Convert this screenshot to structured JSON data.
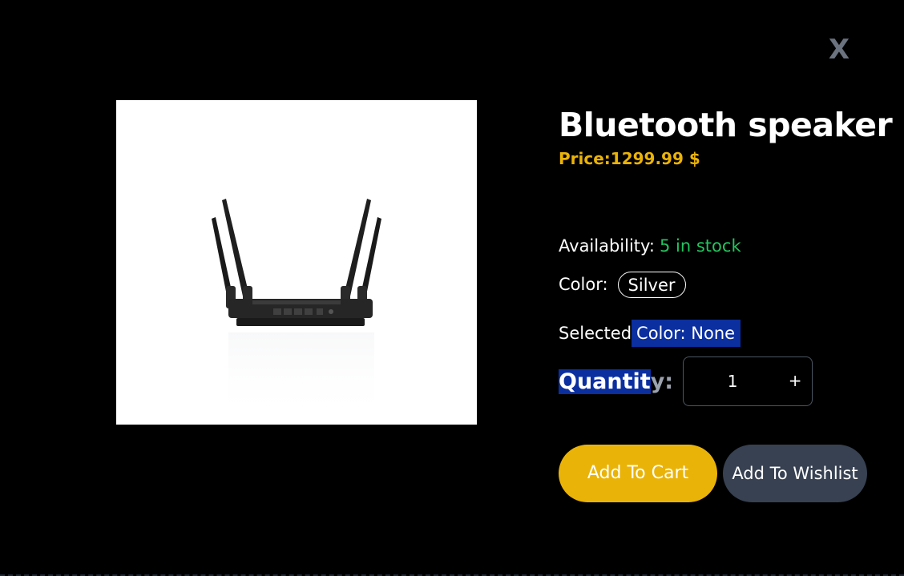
{
  "modal": {
    "close_label": "X"
  },
  "product": {
    "title": "Bluetooth speaker",
    "price": "Price:1299.99 $",
    "availability_label": "Availability:",
    "stock": "5 in stock",
    "color_label": "Color:",
    "color_option": "Silver",
    "selected_prefix": "Selected",
    "selected_value": "Color: None",
    "quantity_label_highlight": "Quantit",
    "quantity_label_rest": "y:",
    "quantity_value": "1",
    "quantity_plus": "+"
  },
  "actions": {
    "add_to_cart": "Add To Cart",
    "add_to_wishlist": "Add To Wishlist"
  },
  "colors": {
    "background": "#000000",
    "price": "#eab308",
    "in_stock": "#22c55e",
    "cart_button": "#eab308",
    "wishlist_button": "#374151",
    "selection_highlight": "#0b2f9f",
    "close_icon": "#6b7280"
  },
  "icons": {
    "close": "close-icon",
    "product_image": "router-image"
  }
}
